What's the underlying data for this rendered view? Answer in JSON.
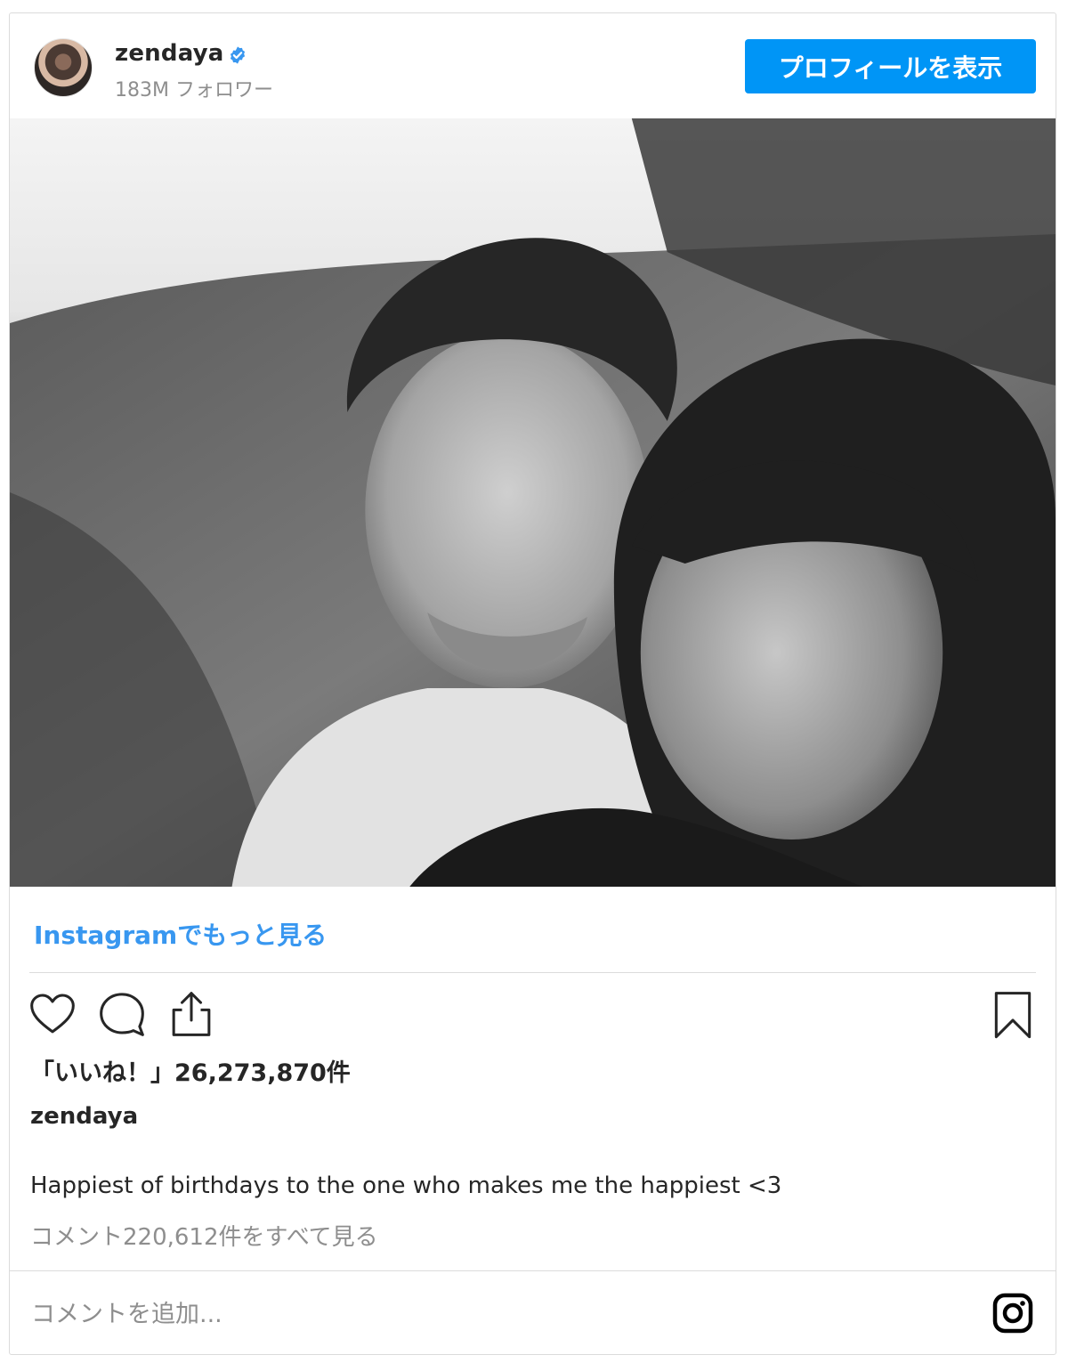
{
  "post": {
    "username": "zendaya",
    "followers": "183M フォロワー",
    "profile_button": "プロフィールを表示",
    "more_link": "Instagramでもっと見る",
    "likes": "「いいね！」26,273,870件",
    "caption_user": "zendaya",
    "caption": "Happiest of birthdays to the one who makes me the happiest <3",
    "view_comments": "コメント220,612件をすべて見る",
    "comment_placeholder": "コメントを追加..."
  },
  "icons": {
    "verified": "verified-badge-icon",
    "like": "heart-icon",
    "comment": "comment-bubble-icon",
    "share": "share-icon",
    "save": "bookmark-icon",
    "instagram": "instagram-logo-icon"
  },
  "colors": {
    "accent": "#0095f6",
    "link": "#3897f0",
    "verified": "#3897f0",
    "muted": "#8e8e8e"
  }
}
